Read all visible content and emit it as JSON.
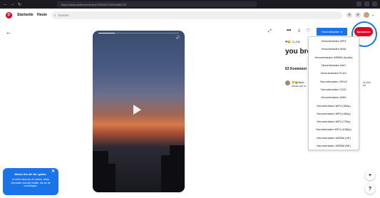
{
  "browser": {
    "url": "https://www.pinterest.de/pin/755549747899908170/"
  },
  "header": {
    "logo": "P",
    "nav": [
      "Startseite",
      "Heute"
    ],
    "search_placeholder": "Suchen"
  },
  "pin": {
    "reactions_count": "11,23k",
    "title": "you bro",
    "comments_label": "63 Komment",
    "comment_author": "🤔😭Bish…",
    "comment_text": "etwas auf w",
    "comment_right_1": "st sich",
    "comment_right_2": "eh"
  },
  "actions": {
    "download_label": "Herunterladen",
    "save_label": "Speichern"
  },
  "download_menu": [
    "Herunterladen MP3",
    "Herunterladen M4A",
    "Herunterladen WEBM (Audio)",
    "Herunterladen AAC",
    "Herunterladen FLAC",
    "Herunterladen OPUS",
    "Herunterladen OGG",
    "Herunterladen WAV",
    "Herunterladen MP4 (360p)",
    "Herunterladen MP4 (480p)",
    "Herunterladen MP4 (720p)",
    "Herunterladen MP4 (1080p)",
    "Herunterladen WEBM (4K)",
    "Herunterladen WEBM (8K)"
  ],
  "promo": {
    "title": "Merke Ihn dir für später.",
    "body": "Je mehr Ideen du dir merkst, desto relevanter sind die Inhalte, die wir dir vorschlagen."
  },
  "fab": {
    "plus": "+",
    "help": "?"
  },
  "colors": {
    "brand": "#e60023",
    "accent": "#1a73e8"
  }
}
